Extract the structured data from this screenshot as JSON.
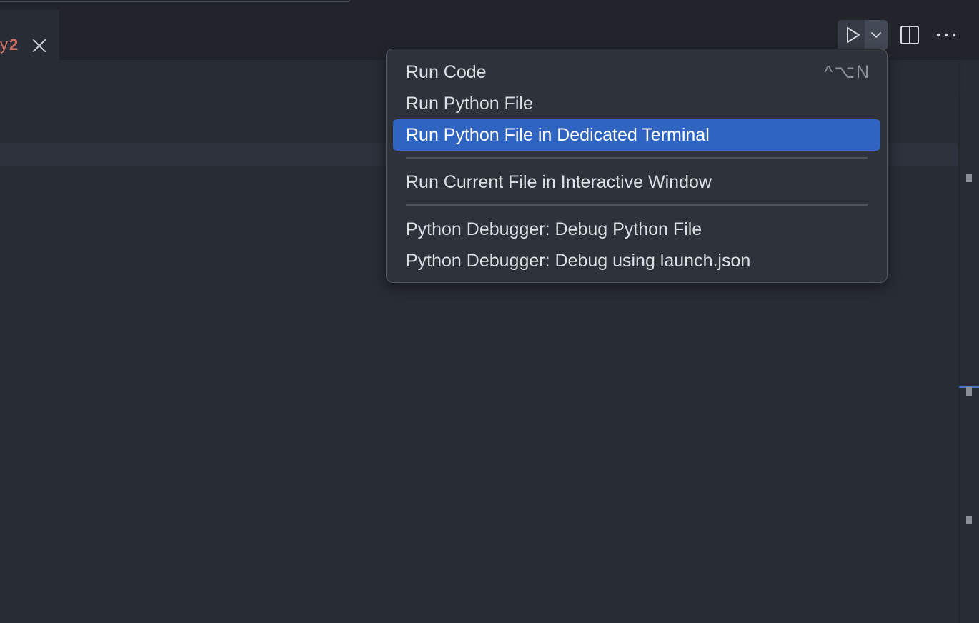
{
  "tab": {
    "tail_glyph": "y",
    "problem_count": "2"
  },
  "toolbar": {
    "run_icon": "play-icon",
    "dropdown_icon": "chevron-down-icon",
    "split_icon": "split-editor-icon",
    "more_icon": "ellipsis-icon"
  },
  "menu": {
    "items": [
      {
        "label": "Run Code",
        "keybinding": "^⌥N"
      },
      {
        "label": "Run Python File"
      },
      {
        "label": "Run Python File in Dedicated Terminal"
      },
      {
        "label": "Run Current File in Interactive Window"
      },
      {
        "label": "Python Debugger: Debug Python File"
      },
      {
        "label": "Python Debugger: Debug using launch.json"
      }
    ]
  },
  "colors": {
    "editor_bg": "#282c34",
    "menu_bg": "#2e3239",
    "selection": "#2f65c0",
    "error": "#d16d60"
  }
}
